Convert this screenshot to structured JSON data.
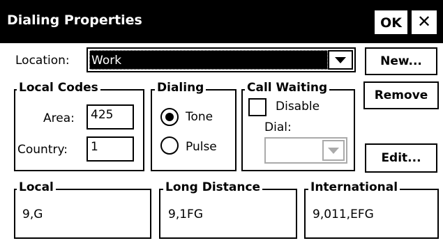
{
  "window": {
    "title": "Dialing Properties",
    "ok_label": "OK",
    "close_label": "✕"
  },
  "location": {
    "label": "Location:",
    "value": "Work"
  },
  "buttons": {
    "new": "New...",
    "remove": "Remove",
    "edit": "Edit..."
  },
  "local_codes": {
    "title": "Local Codes",
    "area_label": "Area:",
    "area_value": "425",
    "country_label": "Country:",
    "country_value": "1"
  },
  "dialing": {
    "title": "Dialing",
    "tone_label": "Tone",
    "pulse_label": "Pulse",
    "selected": "Tone"
  },
  "call_waiting": {
    "title": "Call Waiting",
    "disable_label": "Disable",
    "disable_checked": false,
    "dial_label": "Dial:",
    "dial_value": ""
  },
  "patterns": {
    "local_title": "Local",
    "local_value": "9,G",
    "long_distance_title": "Long Distance",
    "long_distance_value": "9,1FG",
    "international_title": "International",
    "international_value": "9,011,EFG"
  }
}
